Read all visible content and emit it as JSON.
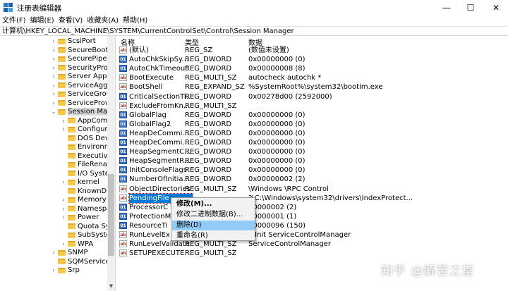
{
  "window": {
    "title": "注册表编辑器",
    "min": "—",
    "max": "☐",
    "close": "✕"
  },
  "menu": [
    "文件(F)",
    "编辑(E)",
    "查看(V)",
    "收藏夹(A)",
    "帮助(H)"
  ],
  "address": "计算机\\HKEY_LOCAL_MACHINE\\SYSTEM\\CurrentControlSet\\Control\\Session Manager",
  "tree": [
    {
      "label": "ScsiPort",
      "level": 1,
      "expander": "›"
    },
    {
      "label": "SecureBoot",
      "level": 1,
      "expander": "›"
    },
    {
      "label": "SecurePipeServ",
      "level": 1,
      "expander": "›"
    },
    {
      "label": "SecurityProvid",
      "level": 1,
      "expander": "›"
    },
    {
      "label": "Server Applica",
      "level": 1,
      "expander": "›"
    },
    {
      "label": "ServiceAggreg",
      "level": 1,
      "expander": "›"
    },
    {
      "label": "ServiceGroupO",
      "level": 1,
      "expander": "›"
    },
    {
      "label": "ServiceProvide",
      "level": 1,
      "expander": "›"
    },
    {
      "label": "Session Manag",
      "level": 1,
      "expander": "⌄",
      "selected": true
    },
    {
      "label": "AppCompa",
      "level": 2,
      "expander": "›"
    },
    {
      "label": "Configuratio",
      "level": 2,
      "expander": "›"
    },
    {
      "label": "DOS Device",
      "level": 2,
      "expander": ""
    },
    {
      "label": "Environmer",
      "level": 2,
      "expander": ""
    },
    {
      "label": "Executive",
      "level": 2,
      "expander": ""
    },
    {
      "label": "FileRename",
      "level": 2,
      "expander": ""
    },
    {
      "label": "I/O System",
      "level": 2,
      "expander": ""
    },
    {
      "label": "kernel",
      "level": 2,
      "expander": "›"
    },
    {
      "label": "KnownDLLs",
      "level": 2,
      "expander": ""
    },
    {
      "label": "Memory Ma",
      "level": 2,
      "expander": "›"
    },
    {
      "label": "Namespace",
      "level": 2,
      "expander": "›"
    },
    {
      "label": "Power",
      "level": 2,
      "expander": "›"
    },
    {
      "label": "Quota Syste",
      "level": 2,
      "expander": ""
    },
    {
      "label": "SubSystems",
      "level": 2,
      "expander": ""
    },
    {
      "label": "WPA",
      "level": 2,
      "expander": "›"
    },
    {
      "label": "SNMP",
      "level": 1,
      "expander": "›"
    },
    {
      "label": "SQMServiceLis",
      "level": 1,
      "expander": ""
    },
    {
      "label": "Srp",
      "level": 1,
      "expander": "›"
    }
  ],
  "columns": {
    "name": "名称",
    "type": "类型",
    "data": "数据"
  },
  "values": [
    {
      "name": "(默认)",
      "type": "REG_SZ",
      "data": "(数值未设置)",
      "icon": "sz"
    },
    {
      "name": "AutoChkSkipSy...",
      "type": "REG_DWORD",
      "data": "0x00000000 (0)",
      "icon": "dw"
    },
    {
      "name": "AutoChkTimeout",
      "type": "REG_DWORD",
      "data": "0x00000008 (8)",
      "icon": "dw"
    },
    {
      "name": "BootExecute",
      "type": "REG_MULTI_SZ",
      "data": "autocheck autochk *",
      "icon": "sz"
    },
    {
      "name": "BootShell",
      "type": "REG_EXPAND_SZ",
      "data": "%SystemRoot%\\system32\\bootim.exe",
      "icon": "sz"
    },
    {
      "name": "CriticalSectionTi...",
      "type": "REG_DWORD",
      "data": "0x00278d00 (2592000)",
      "icon": "dw"
    },
    {
      "name": "ExcludeFromKn...",
      "type": "REG_MULTI_SZ",
      "data": "",
      "icon": "sz"
    },
    {
      "name": "GlobalFlag",
      "type": "REG_DWORD",
      "data": "0x00000000 (0)",
      "icon": "dw"
    },
    {
      "name": "GlobalFlag2",
      "type": "REG_DWORD",
      "data": "0x00000000 (0)",
      "icon": "dw"
    },
    {
      "name": "HeapDeCommi...",
      "type": "REG_DWORD",
      "data": "0x00000000 (0)",
      "icon": "dw"
    },
    {
      "name": "HeapDeCommi...",
      "type": "REG_DWORD",
      "data": "0x00000000 (0)",
      "icon": "dw"
    },
    {
      "name": "HeapSegmentC...",
      "type": "REG_DWORD",
      "data": "0x00000000 (0)",
      "icon": "dw"
    },
    {
      "name": "HeapSegmentR...",
      "type": "REG_DWORD",
      "data": "0x00000000 (0)",
      "icon": "dw"
    },
    {
      "name": "InitConsoleFlags",
      "type": "REG_DWORD",
      "data": "0x00000000 (0)",
      "icon": "dw"
    },
    {
      "name": "NumberOfInitia...",
      "type": "REG_DWORD",
      "data": "0x00000002 (2)",
      "icon": "dw"
    },
    {
      "name": "ObjectDirectories",
      "type": "REG_MULTI_SZ",
      "data": "\\Windows \\RPC Control",
      "icon": "sz"
    },
    {
      "name": "PendingFile",
      "type": "",
      "data": "?\\C:\\Windows\\system32\\drivers\\IndexProtect...",
      "icon": "sz",
      "selected": true
    },
    {
      "name": "ProcessorC",
      "type": "",
      "data": "00000002 (2)",
      "icon": "dw"
    },
    {
      "name": "ProtectionM",
      "type": "",
      "data": "00000001 (1)",
      "icon": "dw"
    },
    {
      "name": "ResourceTi",
      "type": "",
      "data": "00000096 (150)",
      "icon": "dw"
    },
    {
      "name": "RunLevelEx",
      "type": "",
      "data": "inInit ServiceControlManager",
      "icon": "sz"
    },
    {
      "name": "RunLevelValidate",
      "type": "REG_MULTI_SZ",
      "data": "ServiceControlManager",
      "icon": "sz"
    },
    {
      "name": "SETUPEXECUTE",
      "type": "REG_MULTI_SZ",
      "data": "",
      "icon": "sz"
    }
  ],
  "context_menu": [
    {
      "label": "修改(M)...",
      "bold": true
    },
    {
      "label": "修改二进制数据(B)..."
    },
    {
      "label": "删除(D)",
      "hover": true
    },
    {
      "label": "重命名(R)"
    }
  ],
  "watermark": "知乎 @解苦之堂"
}
